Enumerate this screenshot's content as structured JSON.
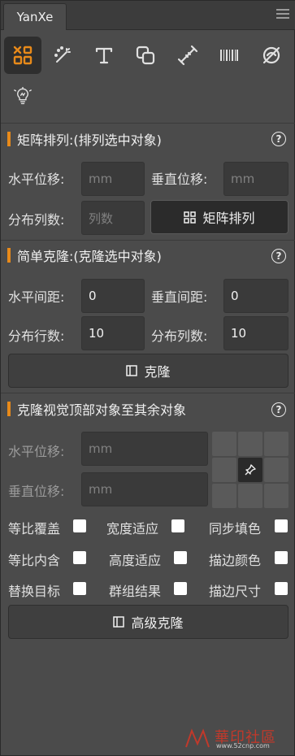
{
  "panel": {
    "tab_title": "YanXe"
  },
  "toolbar": {
    "tools": [
      "matrix-icon",
      "magic-wand-icon",
      "text-icon",
      "shapes-icon",
      "measure-icon",
      "barcode-icon",
      "eye-off-icon",
      "bulb-icon"
    ],
    "active_tool": "matrix-icon",
    "accent": "#e88a1a"
  },
  "matrix": {
    "title": "矩阵排列:(排列选中对象)",
    "h_offset_label": "水平位移:",
    "h_offset_placeholder": "mm",
    "v_offset_label": "垂直位移:",
    "v_offset_placeholder": "mm",
    "cols_label": "分布列数:",
    "cols_placeholder": "列数",
    "button": "矩阵排列"
  },
  "simple_clone": {
    "title": "简单克隆:(克隆选中对象)",
    "h_gap_label": "水平间距:",
    "h_gap_value": "0",
    "v_gap_label": "垂直间距:",
    "v_gap_value": "0",
    "rows_label": "分布行数:",
    "rows_value": "10",
    "cols_label": "分布列数:",
    "cols_value": "10",
    "button": "克隆"
  },
  "advanced_clone": {
    "title": "克隆视觉顶部对象至其余对象",
    "h_offset_label": "水平位移:",
    "h_offset_placeholder": "mm",
    "v_offset_label": "垂直位移:",
    "v_offset_placeholder": "mm",
    "options": [
      {
        "label": "等比覆盖",
        "checked": false
      },
      {
        "label": "宽度适应",
        "checked": false
      },
      {
        "label": "同步填色",
        "checked": false
      },
      {
        "label": "等比内含",
        "checked": false
      },
      {
        "label": "高度适应",
        "checked": false
      },
      {
        "label": "描边颜色",
        "checked": false
      },
      {
        "label": "替换目标",
        "checked": false
      },
      {
        "label": "群组结果",
        "checked": false
      },
      {
        "label": "描边尺寸",
        "checked": false
      }
    ],
    "button": "高级克隆"
  },
  "watermark": {
    "brand": "華印社區",
    "url": "www.52cnp.com",
    "color": "#c0392b"
  }
}
